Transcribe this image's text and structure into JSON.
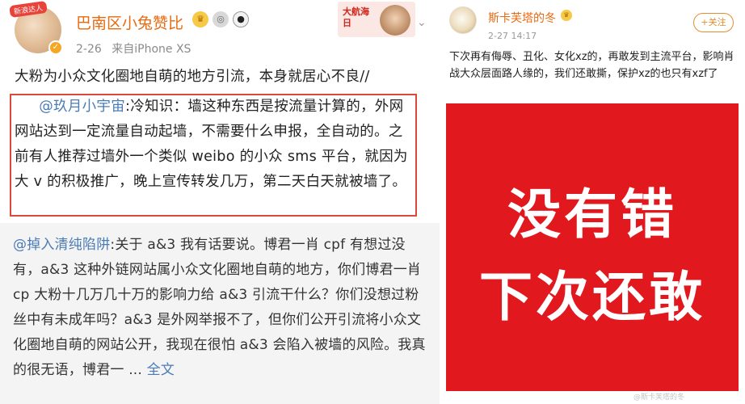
{
  "left_post": {
    "avatar": {
      "ribbon_text": "新浪达人",
      "vip_icon": "v-badge-icon"
    },
    "username": "巴南区小兔赞比",
    "badges": [
      {
        "icon": "crown-icon",
        "glyph": "♛"
      },
      {
        "icon": "medal-icon",
        "glyph": "◎"
      },
      {
        "icon": "panda-icon",
        "glyph": "🐼"
      }
    ],
    "time": "2-26",
    "source": "来自iPhone XS",
    "promo": {
      "text": "大航海日"
    },
    "chevron": "chevron-down-icon",
    "body_lead": "大粉为小众文化圈地自萌的地方引流，本身就居心不良//",
    "quote_mention": "@玖月小宇宙",
    "quote_text": ":冷知识：墙这种东西是按流量计算的，外网网站达到一定流量自动起墙，不需要什么申报，全自动的。之前有人推荐过墙外一个类似 weibo 的小众 sms 平台，就因为大 v 的积极推广，晚上宣传转发几万，第二天白天就被墙了。",
    "repost": {
      "mention": "@掉入清纯陷阱",
      "text": ":关于 a&3 我有话要说。博君一肖 cpf 有想过没有，a&3 这种外链网站属小众文化圈地自萌的地方，你们博君一肖 cp 大粉十几万几十万的影响力给 a&3 引流干什么？你们没想过粉丝中有未成年吗？a&3 是外网举报不了，但你们公开引流将小众文化圈地自萌的网站公开，我现在很怕 a&3 会陷入被墙的风险。我真的很无语，博君一 ... ",
      "full_text_link": "全文"
    }
  },
  "right_post": {
    "username": "斯卡芙塔的冬",
    "crown_glyph": "♛",
    "date": "2-27 14:17",
    "follow_label": "+关注",
    "body": "下次再有侮辱、丑化、女化xz的，再敢发到主流平台，影响肖战大众层面路人缘的，我们还敢撕，保护xz的也只有xzf了",
    "poster": {
      "line1": "没有错",
      "line2": "下次还敢",
      "background": "#e2181f"
    },
    "watermark": "@斯卡芙塔的冬"
  },
  "colors": {
    "username": "#e86a10",
    "mention": "#4a7bb7",
    "highlight_box": "#d94a3a",
    "repost_bg": "#f4f4f4"
  }
}
